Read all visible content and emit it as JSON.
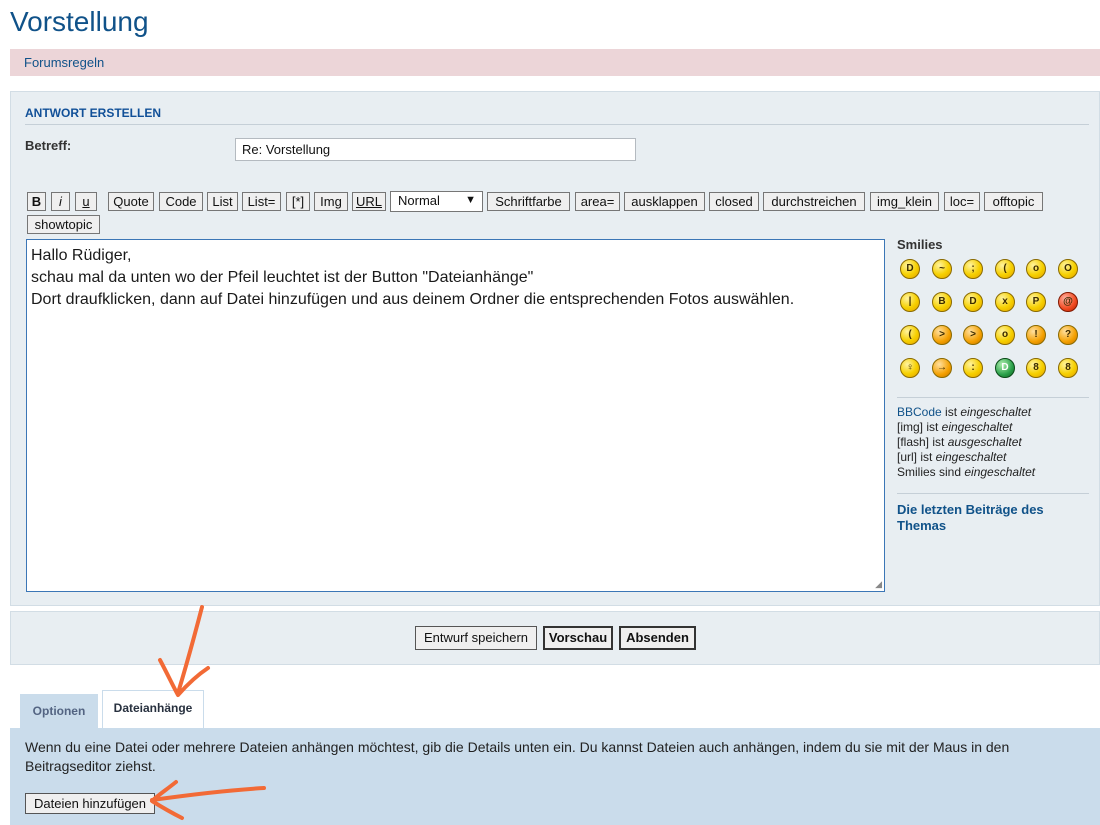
{
  "page": {
    "title": "Vorstellung"
  },
  "rules": {
    "link": "Forumsregeln"
  },
  "reply": {
    "heading": "ANTWORT ERSTELLEN",
    "subject_label": "Betreff:",
    "subject_value": "Re: Vorstellung"
  },
  "toolbar": {
    "buttons": [
      "B",
      "i",
      "u",
      "Quote",
      "Code",
      "List",
      "List=",
      "[*]",
      "Img",
      "URL",
      "Schriftfarbe",
      "area=",
      "ausklappen",
      "closed",
      "durchstreichen",
      "img_klein",
      "loc=",
      "offtopic",
      "showtopic"
    ],
    "font_size_selected": "Normal",
    "select_arrow": "▼"
  },
  "message": {
    "lines": [
      "Hallo Rüdiger,",
      "schau mal da unten wo der Pfeil leuchtet ist der Button \"Dateianhänge\"",
      "Dort draufklicken, dann auf Datei hinzufügen und aus deinem Ordner die entsprechenden Fotos auswählen."
    ]
  },
  "smilies": {
    "heading": "Smilies",
    "icons": [
      "laughing-icon",
      "confused-icon",
      "wink-icon",
      "sad-icon",
      "surprised-icon",
      "eek-icon",
      "neutral-icon",
      "cool-icon",
      "grin-icon",
      "mad-icon",
      "razz-icon",
      "angry-icon",
      "frown-icon",
      "evil-icon",
      "twisted-icon",
      "rolleyes-icon",
      "exclaim-icon",
      "question-icon",
      "idea-icon",
      "arrow-icon",
      "smirk-icon",
      "green-grin-icon",
      "geek-icon",
      "nerd-icon"
    ]
  },
  "status": {
    "bbcode_link": "BBCode",
    "bbcode_rest": " ist ",
    "bbcode_state": "eingeschaltet",
    "img_label": "[img] ist ",
    "img_state": "eingeschaltet",
    "flash_label": "[flash] ist ",
    "flash_state": "ausgeschaltet",
    "url_label": "[url] ist ",
    "url_state": "eingeschaltet",
    "smilies_label": "Smilies sind ",
    "smilies_state": "eingeschaltet",
    "last_posts": "Die letzten Beiträge des Themas"
  },
  "submit": {
    "draft": "Entwurf speichern",
    "preview": "Vorschau",
    "send": "Absenden"
  },
  "tabs": {
    "options": "Optionen",
    "attachments": "Dateianhänge"
  },
  "attachments": {
    "info": "Wenn du eine Datei oder mehrere Dateien anhängen möchtest, gib die Details unten ein. Du kannst Dateien auch anhängen, indem du sie mit der Maus in den Beitragseditor ziehst.",
    "add_button": "Dateien hinzufügen"
  },
  "colors": {
    "link": "#105289",
    "panel_bg": "#e8eef2",
    "rules_bg": "#ecd5d8",
    "attach_bg": "#cadceb",
    "annotation_arrow": "#f26a36"
  }
}
